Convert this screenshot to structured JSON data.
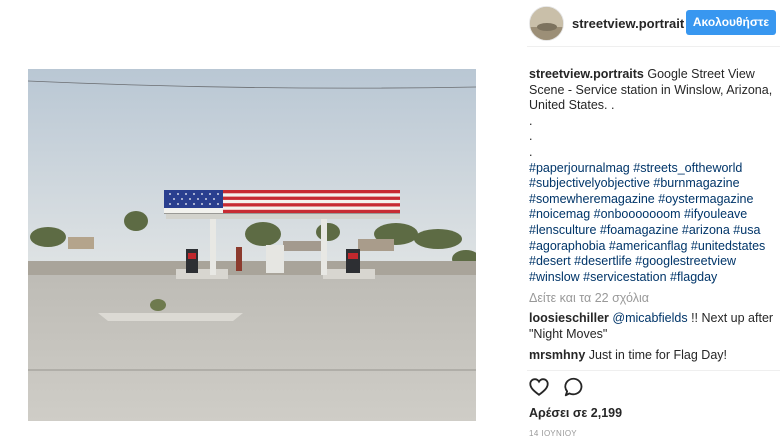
{
  "post": {
    "photo_alt": "Service station in Winslow, Arizona"
  },
  "header": {
    "username": "streetview.portrait",
    "follow_label": "Ακολουθήστε"
  },
  "caption": {
    "author": "streetview.portraits",
    "text": "Google Street View Scene - Service station in Winslow, Arizona, United States. .",
    "dots": [
      ".",
      ".",
      "."
    ],
    "hashtag_lines": [
      "#paperjournalmag #streets_oftheworld",
      "#subjectivelyobjective #burnmagazine",
      "#somewheremagazine #oystermagazine",
      "#noicemag #onbooooooom #ifyouleave",
      "#lensculture #foamagazine #arizona #usa",
      "#agoraphobia #americanflag #unitedstates",
      "#desert #desertlife #googlestreetview",
      "#winslow #servicestation #flagday"
    ]
  },
  "view_all_comments": "Δείτε και τα 22 σχόλια",
  "comments": [
    {
      "author": "loosieschiller",
      "mention": "@micabfields",
      "text": " !! Next up after \"Night Moves\""
    },
    {
      "author": "mrsmhny",
      "mention": "",
      "text": " Just in time for Flag Day!"
    }
  ],
  "icons": {
    "like": "heart-icon",
    "comment": "speech-bubble-icon"
  },
  "likes_text": "Αρέσει σε 2,199",
  "timestamp": "14 ΙΟΥΝΙΟΥ",
  "colors": {
    "follow_button": "#3897f0",
    "hashtag": "#003569",
    "muted": "#999999"
  }
}
